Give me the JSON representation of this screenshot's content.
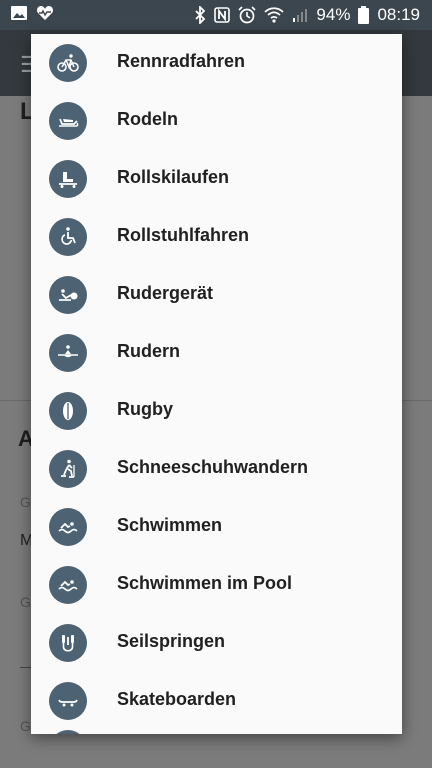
{
  "status_bar": {
    "battery": "94%",
    "time": "08:19",
    "icons": [
      "image-icon",
      "heart-monitor-icon",
      "bluetooth-icon",
      "nfc-icon",
      "alarm-icon",
      "wifi-icon",
      "signal-icon",
      "battery-icon"
    ]
  },
  "background": {
    "partial_texts": [
      "L",
      "A",
      "G",
      "M",
      "G",
      "G"
    ]
  },
  "dialog": {
    "items": [
      {
        "label": "Rennradfahren",
        "icon": "road-bike-icon"
      },
      {
        "label": "Rodeln",
        "icon": "sled-icon"
      },
      {
        "label": "Rollskilaufen",
        "icon": "roller-ski-icon"
      },
      {
        "label": "Rollstuhlfahren",
        "icon": "wheelchair-icon"
      },
      {
        "label": "Rudergerät",
        "icon": "rowing-machine-icon"
      },
      {
        "label": "Rudern",
        "icon": "rowing-icon"
      },
      {
        "label": "Rugby",
        "icon": "rugby-ball-icon"
      },
      {
        "label": "Schneeschuhwandern",
        "icon": "snowshoe-icon"
      },
      {
        "label": "Schwimmen",
        "icon": "swimming-icon"
      },
      {
        "label": "Schwimmen im Pool",
        "icon": "pool-swimming-icon"
      },
      {
        "label": "Seilspringen",
        "icon": "jump-rope-icon"
      },
      {
        "label": "Skateboarden",
        "icon": "skateboard-icon"
      }
    ]
  },
  "colors": {
    "icon_circle": "#4d6272",
    "status_bar": "#3c464e",
    "dialog_bg": "#fafafa"
  }
}
